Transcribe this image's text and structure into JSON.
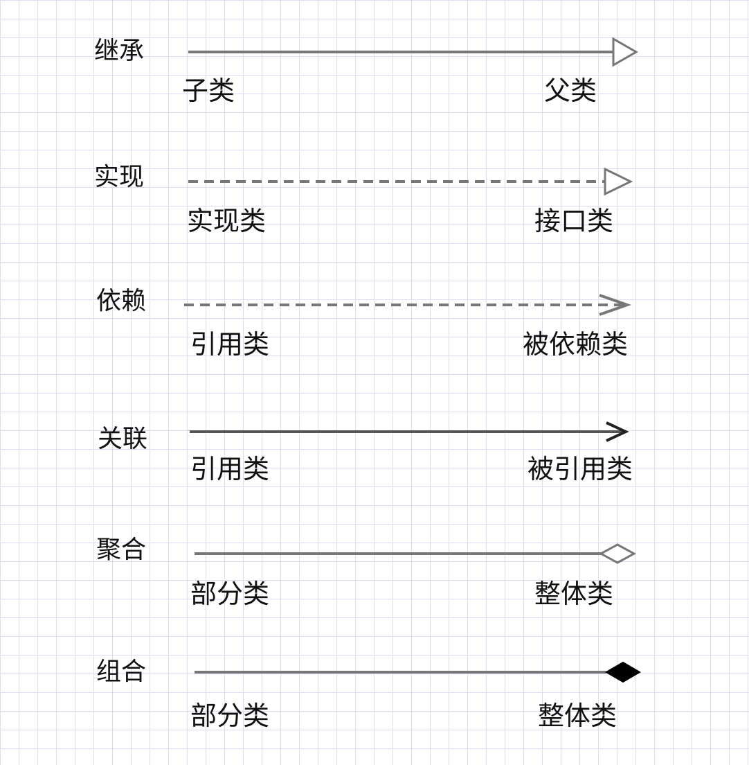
{
  "diagram": {
    "relations": [
      {
        "id": "inheritance",
        "name": "继承",
        "source_label": "子类",
        "target_label": "父类",
        "line_style": "solid",
        "arrowhead": "hollow-triangle",
        "arrowhead_icon": "hollow-triangle-arrowhead-icon"
      },
      {
        "id": "realization",
        "name": "实现",
        "source_label": "实现类",
        "target_label": "接口类",
        "line_style": "dashed",
        "arrowhead": "hollow-triangle",
        "arrowhead_icon": "hollow-triangle-arrowhead-icon"
      },
      {
        "id": "dependency",
        "name": "依赖",
        "source_label": "引用类",
        "target_label": "被依赖类",
        "line_style": "dashed",
        "arrowhead": "open-arrow",
        "arrowhead_icon": "open-arrowhead-icon"
      },
      {
        "id": "association",
        "name": "关联",
        "source_label": "引用类",
        "target_label": "被引用类",
        "line_style": "solid",
        "arrowhead": "open-arrow",
        "arrowhead_icon": "open-arrowhead-icon"
      },
      {
        "id": "aggregation",
        "name": "聚合",
        "source_label": "部分类",
        "target_label": "整体类",
        "line_style": "solid",
        "arrowhead": "hollow-diamond",
        "arrowhead_icon": "hollow-diamond-icon"
      },
      {
        "id": "composition",
        "name": "组合",
        "source_label": "部分类",
        "target_label": "整体类",
        "line_style": "solid",
        "arrowhead": "filled-diamond",
        "arrowhead_icon": "filled-diamond-icon"
      }
    ],
    "colors": {
      "edge": "#777777",
      "text": "#111111",
      "grid": "#dcdcf2",
      "diamond_fill": "#000000"
    }
  }
}
